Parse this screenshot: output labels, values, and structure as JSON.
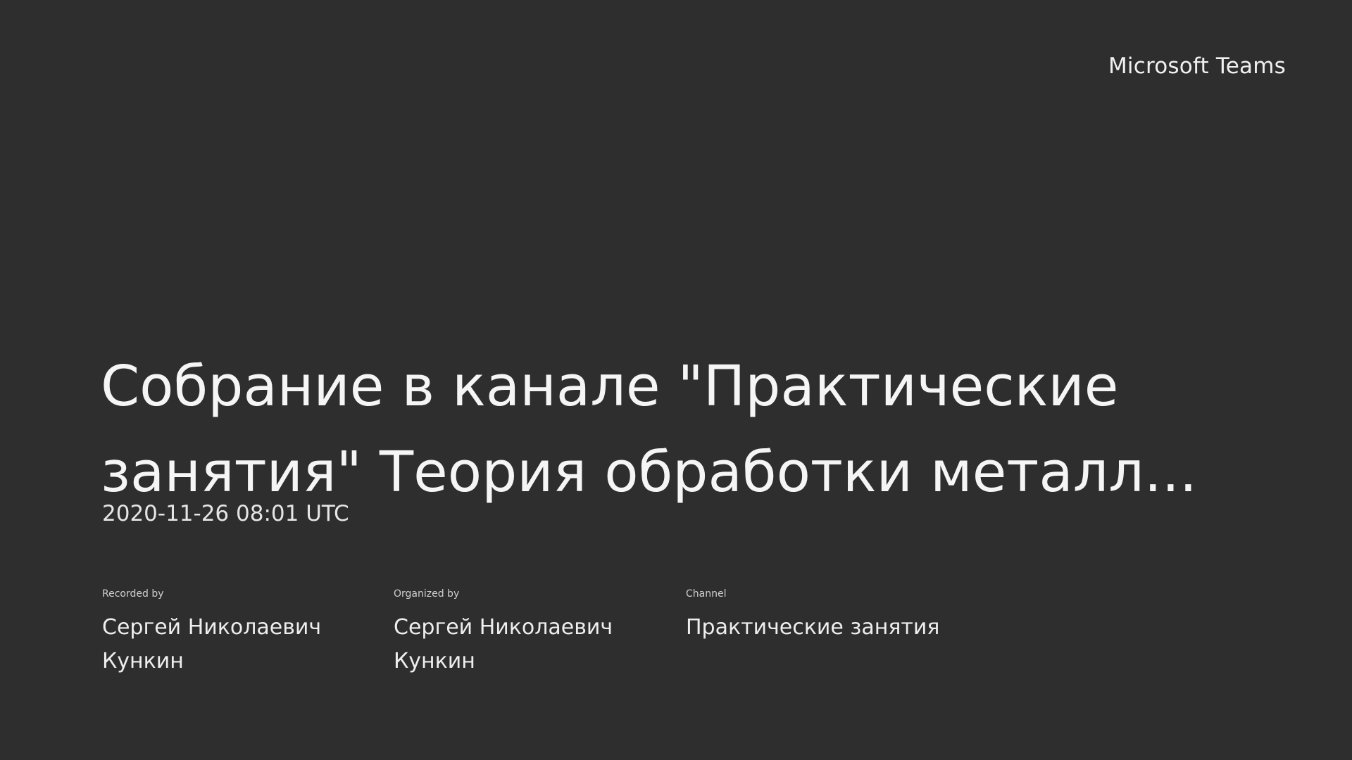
{
  "brand": {
    "name": "Microsoft Teams"
  },
  "meeting": {
    "title": "Собрание в канале \"Практические занятия\"  Теория обработки металл...",
    "timestamp": "2020-11-26 08:01 UTC"
  },
  "details": {
    "recorded_by": {
      "label": "Recorded by",
      "value": "Сергей Николаевич Кункин"
    },
    "organized_by": {
      "label": "Organized by",
      "value": "Сергей Николаевич Кункин"
    },
    "channel": {
      "label": "Channel",
      "value": "Практические занятия"
    }
  },
  "colors": {
    "background": "#2e2e2e",
    "text": "#ffffff"
  }
}
